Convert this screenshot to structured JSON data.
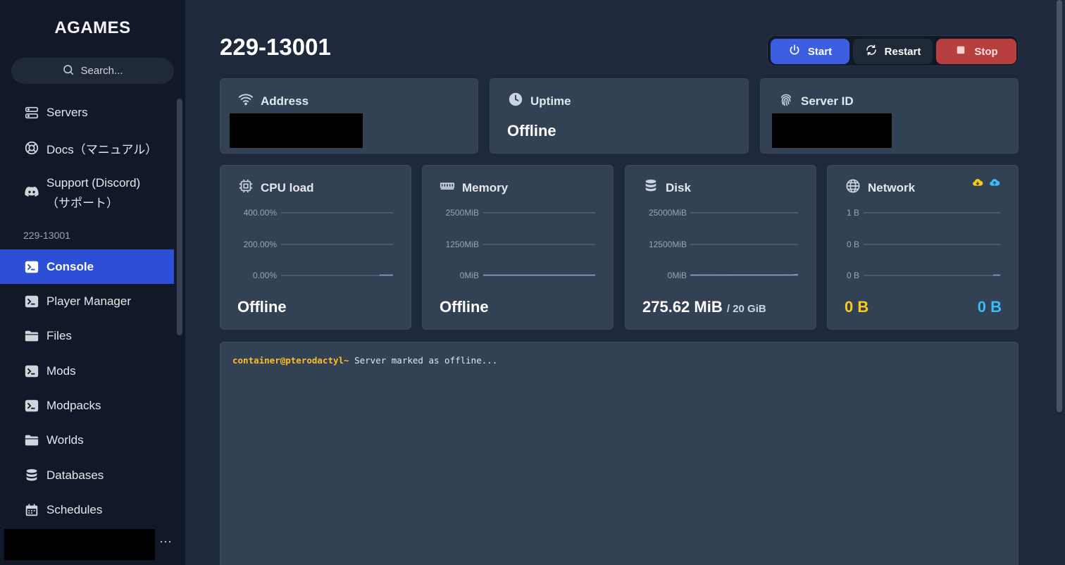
{
  "brand": "AGAMES",
  "search": {
    "placeholder": "Search..."
  },
  "nav": {
    "top": [
      {
        "label": "Servers",
        "icon": "server-icon"
      },
      {
        "label": "Docs（マニュアル）",
        "icon": "lifebuoy-icon"
      },
      {
        "label": "Support (Discord)",
        "label2": "（サポート）",
        "icon": "discord-icon"
      }
    ],
    "section": "229-13001",
    "items": [
      {
        "label": "Console",
        "icon": "terminal-icon",
        "active": true
      },
      {
        "label": "Player Manager",
        "icon": "terminal-icon"
      },
      {
        "label": "Files",
        "icon": "folder-icon"
      },
      {
        "label": "Mods",
        "icon": "terminal-icon"
      },
      {
        "label": "Modpacks",
        "icon": "terminal-icon"
      },
      {
        "label": "Worlds",
        "icon": "folder-icon"
      },
      {
        "label": "Databases",
        "icon": "database-icon"
      },
      {
        "label": "Schedules",
        "icon": "calendar-icon"
      }
    ],
    "more": "···"
  },
  "server": {
    "title": "229-13001"
  },
  "power": {
    "start": "Start",
    "restart": "Restart",
    "stop": "Stop"
  },
  "info": {
    "address": {
      "label": "Address"
    },
    "uptime": {
      "label": "Uptime",
      "value": "Offline"
    },
    "server_id": {
      "label": "Server ID"
    }
  },
  "stats": {
    "cpu": {
      "label": "CPU load",
      "ticks": [
        "400.00%",
        "200.00%",
        "0.00%"
      ],
      "value": "Offline"
    },
    "memory": {
      "label": "Memory",
      "ticks": [
        "2500MiB",
        "1250MiB",
        "0MiB"
      ],
      "value": "Offline"
    },
    "disk": {
      "label": "Disk",
      "ticks": [
        "25000MiB",
        "12500MiB",
        "0MiB"
      ],
      "value": "275.62 MiB",
      "limit": "/ 20 GiB"
    },
    "network": {
      "label": "Network",
      "ticks": [
        "1 B",
        "0 B",
        "0 B"
      ],
      "inbound": "0 B",
      "outbound": "0 B"
    }
  },
  "console": {
    "prompt": "container@pterodactyl~",
    "message": " Server marked as offline..."
  },
  "colors": {
    "accent": "#2d4fd6",
    "start": "#3b5fe0",
    "stop": "#b83f3f",
    "inbound": "#facc15",
    "outbound": "#38bdf8"
  }
}
